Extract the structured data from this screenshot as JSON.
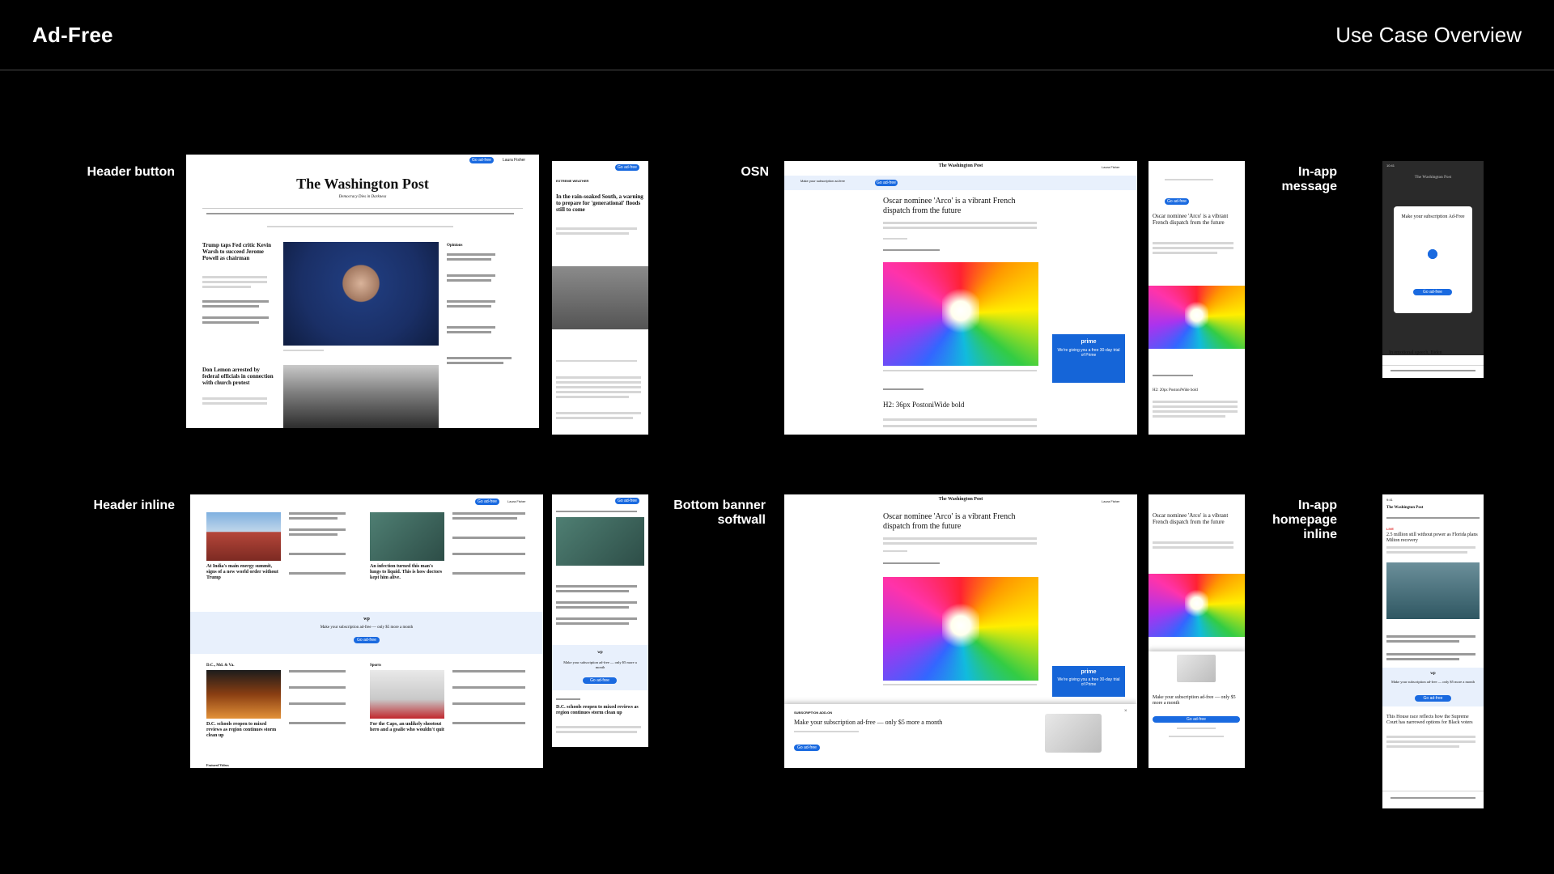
{
  "deck": {
    "title": "Ad-Free",
    "subtitle": "Use Case Overview"
  },
  "labels": {
    "header_button": "Header button",
    "osn": "OSN",
    "in_app_message_line1": "In-app",
    "in_app_message_line2": "message",
    "header_inline": "Header inline",
    "bottom_banner_line1": "Bottom banner",
    "bottom_banner_line2": "softwall",
    "in_app_homepage_line1": "In-app",
    "in_app_homepage_line2": "homepage",
    "in_app_homepage_line3": "inline"
  },
  "shots": {
    "header_button_desktop": {
      "masthead": "The Washington Post",
      "tagline": "Democracy Dies in Darkness",
      "cta": "Go ad-free",
      "user": "Laura Fisher",
      "headline1": "Trump taps Fed critic Kevin Warsh to succeed Jerome Powell as chairman",
      "headline2": "Don Lemon arrested by federal officials in connection with church protest",
      "opinions": "Opinions"
    },
    "header_button_mobile": {
      "cta": "Go ad-free",
      "section": "EXTREME WEATHER",
      "headline": "In the rain-soaked South, a warning to prepare for 'generational' floods still to come"
    },
    "osn_desktop": {
      "masthead": "The Washington Post",
      "user": "Laura Fisher",
      "banner_text": "Make your subscription ad-free",
      "cta": "Go ad-free",
      "headline": "Oscar nominee 'Arco' is a vibrant French dispatch from the future",
      "subhead": "H2: 36px PostoniWide bold",
      "ad_brand": "prime",
      "ad_text": "We're giving you a free 30-day trial of Prime"
    },
    "osn_mobile": {
      "cta": "Go ad-free",
      "headline": "Oscar nominee 'Arco' is a vibrant French dispatch from the future",
      "subhead": "H2: 20px PostoniWide bold"
    },
    "in_app_message": {
      "time": "10:41",
      "masthead": "The Washington Post",
      "modal_title": "Make your subscription Ad-Free",
      "cta": "Go ad-free",
      "headline": "In emotional speech, Biden"
    },
    "header_inline_desktop": {
      "cta_text": "Make your subscription ad-free — only $5 more a month",
      "cta": "Go ad-free",
      "user": "Laura Fisher",
      "headline1": "At India's main energy summit, signs of a new world order without Trump",
      "headline2": "An infection turned this man's lungs to liquid. This is how doctors kept him alive.",
      "section1": "D.C., Md. & Va.",
      "section2": "Sports",
      "headline3": "D.C. schools reopen to mixed reviews as region continues storm clean up",
      "headline4": "For the Caps, an unlikely shootout hero and a goalie who wouldn't quit",
      "footer": "Featured Videos"
    },
    "header_inline_mobile": {
      "cta_text": "Make your subscription ad-free — only $5 more a month",
      "cta": "Go ad-free",
      "headline": "D.C. schools reopen to mixed reviews as region continues storm clean up"
    },
    "bottom_banner_desktop": {
      "masthead": "The Washington Post",
      "user": "Laura Fisher",
      "headline": "Oscar nominee 'Arco' is a vibrant French dispatch from the future",
      "banner_tag": "SUBSCRIPTION ADD-ON",
      "banner_title": "Make your subscription ad-free — only $5 more a month",
      "cta": "Go ad-free",
      "ad_brand": "prime",
      "ad_text": "We're giving you a free 30-day trial of Prime"
    },
    "bottom_banner_mobile": {
      "headline": "Oscar nominee 'Arco' is a vibrant French dispatch from the future",
      "banner_title": "Make your subscription ad-free — only $5 more a month",
      "cta": "Go ad-free"
    },
    "in_app_homepage": {
      "time": "9:41",
      "masthead": "The Washington Post",
      "live": "LIVE",
      "headline1": "2.5 million still without power as Florida plans Milton recovery",
      "cta_text": "Make your subscription ad-free — only $5 more a month",
      "cta": "Go ad-free",
      "headline2": "This House race reflects how the Supreme Court has narrowed options for Black voters"
    }
  }
}
